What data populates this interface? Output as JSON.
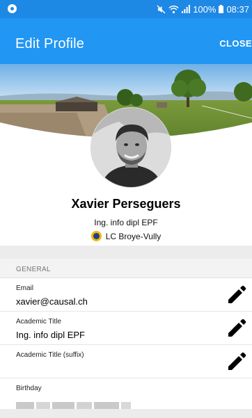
{
  "status_bar": {
    "battery_percent": "100%",
    "time": "08:37",
    "icons": [
      "notification-icon",
      "mute-icon",
      "wifi-icon",
      "signal-icon",
      "battery-icon"
    ]
  },
  "app_bar": {
    "title": "Edit Profile",
    "close_label": "CLOSE"
  },
  "profile": {
    "name": "Xavier Perseguers",
    "subtitle": "Ing. info dipl EPF",
    "club": "LC Broye-Vully"
  },
  "section": {
    "label": "GENERAL"
  },
  "fields": [
    {
      "label": "Email",
      "value": "xavier@causal.ch",
      "editable": true
    },
    {
      "label": "Academic Title",
      "value": "Ing. info dipl EPF",
      "editable": true
    },
    {
      "label": "Academic Title (suffix)",
      "value": "",
      "editable": true
    },
    {
      "label": "Birthday",
      "value": "",
      "editable": false
    }
  ],
  "colors": {
    "status_bar": "#1e88e5",
    "app_bar": "#2196f3",
    "section_background": "#f3f3f3",
    "lions_gold": "#f2b705",
    "lions_blue": "#1c3f94"
  }
}
